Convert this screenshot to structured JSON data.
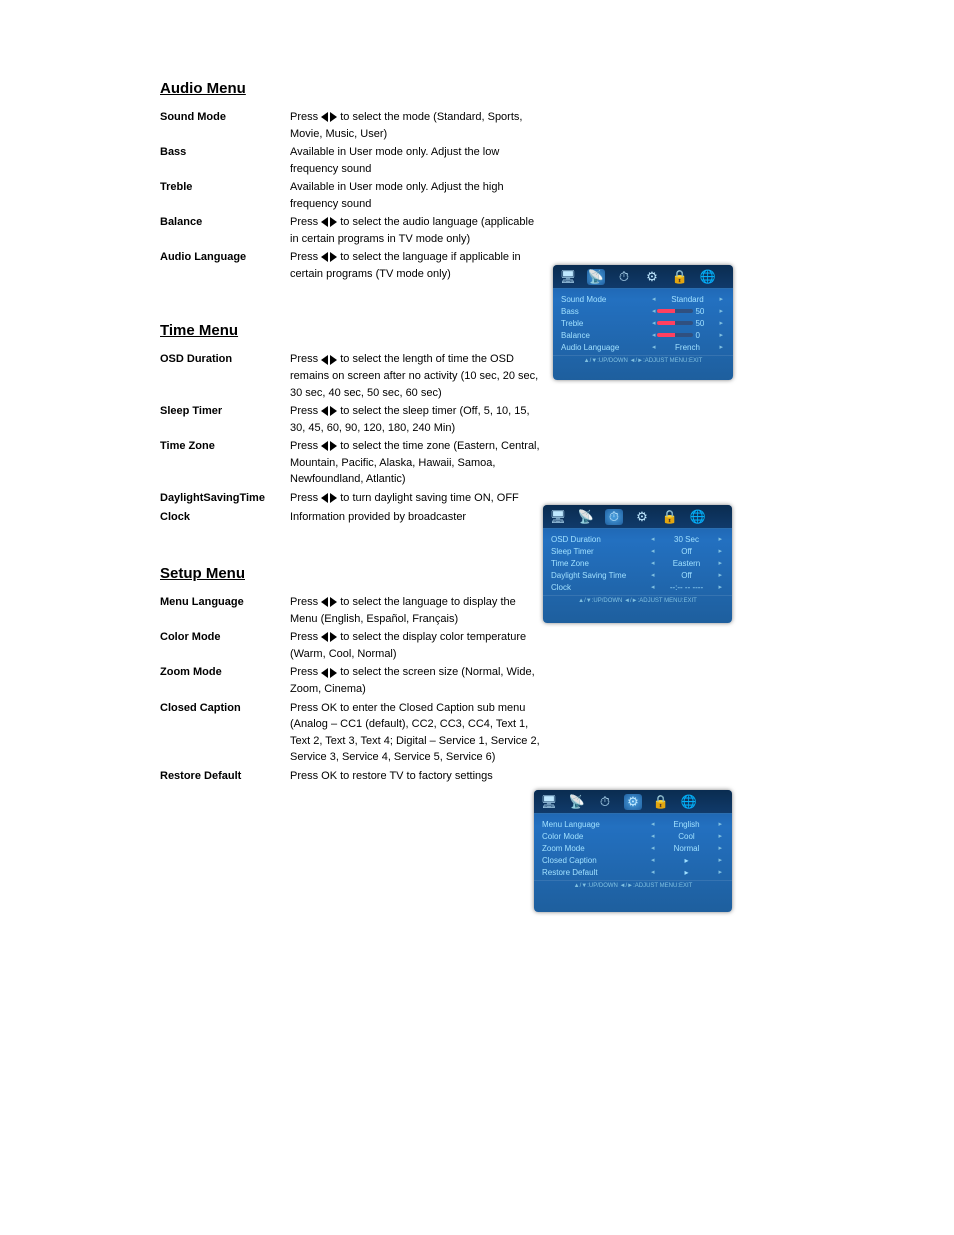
{
  "sections": [
    {
      "title": "Audio Menu",
      "items": [
        {
          "label": "Sound Mode",
          "desc_pre": "Press ",
          "arrows": true,
          "desc_post": " to select the mode (Standard, Sports, Movie, Music, User)"
        },
        {
          "label": "Bass",
          "desc_pre": "",
          "arrows": false,
          "desc_post": "Available in User mode only. Adjust the low frequency sound"
        },
        {
          "label": "Treble",
          "desc_pre": "",
          "arrows": false,
          "desc_post": "Available in User mode only. Adjust the high frequency sound"
        },
        {
          "label": "Balance",
          "desc_pre": "Press ",
          "arrows": true,
          "desc_post": " to select the audio language (applicable in certain programs in TV mode only)"
        },
        {
          "label": "Audio Language",
          "desc_pre": "Press ",
          "arrows": true,
          "desc_post": " to select the language if applicable in certain programs (TV mode only)"
        }
      ]
    },
    {
      "title": "Time Menu",
      "items": [
        {
          "label": "OSD Duration",
          "desc_pre": "Press ",
          "arrows": true,
          "desc_post": " to select the length of time the OSD remains on screen after no activity (10 sec, 20 sec, 30 sec, 40 sec, 50 sec, 60 sec)"
        },
        {
          "label": "Sleep Timer",
          "desc_pre": "Press ",
          "arrows": true,
          "desc_post": " to select the sleep timer (Off, 5, 10, 15, 30, 45, 60, 90, 120, 180, 240 Min)"
        },
        {
          "label": "Time Zone",
          "desc_pre": "Press ",
          "arrows": true,
          "desc_post": " to select the time zone (Eastern, Central, Mountain, Pacific, Alaska, Hawaii, Samoa, Newfoundland, Atlantic)"
        },
        {
          "label": "DaylightSavingTime",
          "desc_pre": "Press ",
          "arrows": true,
          "desc_post": " to turn daylight saving time ON, OFF"
        },
        {
          "label": "Clock",
          "desc_pre": "",
          "arrows": false,
          "desc_post": "Information provided by broadcaster"
        }
      ]
    },
    {
      "title": "Setup Menu",
      "items": [
        {
          "label": "Menu Language",
          "desc_pre": "Press ",
          "arrows": true,
          "desc_post": " to select the language to display the Menu (English, Español, Français)"
        },
        {
          "label": "Color Mode",
          "desc_pre": "Press ",
          "arrows": true,
          "desc_post": " to select the display color temperature (Warm, Cool, Normal)"
        },
        {
          "label": "Zoom Mode",
          "desc_pre": "Press ",
          "arrows": true,
          "desc_post": " to select the screen size (Normal, Wide, Zoom, Cinema)"
        },
        {
          "label": "Closed Caption",
          "desc_pre": "",
          "arrows": false,
          "desc_post": "Press OK to enter the Closed Caption sub menu (Analog – CC1 (default), CC2, CC3, CC4, Text 1, Text 2, Text 3, Text 4; Digital – Service 1, Service 2, Service 3, Service 4, Service 5, Service 6)"
        },
        {
          "label": "Restore Default",
          "desc_pre": "",
          "arrows": false,
          "desc_post": "Press OK to restore TV to factory settings"
        }
      ]
    }
  ],
  "osd1": {
    "footer": "▲/▼:UP/DOWN   ◄/►:ADJUST   MENU:EXIT",
    "icons": [
      "monitor",
      "dish",
      "clock",
      "gear",
      "lock",
      "globe"
    ],
    "active": 1,
    "rows": [
      {
        "l": "Sound Mode",
        "v": "Standard",
        "slider": false
      },
      {
        "l": "Bass",
        "v": "50",
        "slider": true
      },
      {
        "l": "Treble",
        "v": "50",
        "slider": true
      },
      {
        "l": "Balance",
        "v": "0",
        "slider": true
      },
      {
        "l": "Audio Language",
        "v": "French",
        "slider": false
      }
    ]
  },
  "osd2": {
    "footer": "▲/▼:UP/DOWN   ◄/►:ADJUST   MENU:EXIT",
    "icons": [
      "monitor",
      "dish",
      "clock",
      "gear",
      "lock",
      "globe"
    ],
    "active": 2,
    "rows": [
      {
        "l": "OSD Duration",
        "v": "30 Sec"
      },
      {
        "l": "Sleep Timer",
        "v": "Off"
      },
      {
        "l": "Time Zone",
        "v": "Eastern"
      },
      {
        "l": "Daylight Saving Time",
        "v": "Off"
      },
      {
        "l": "Clock",
        "v": "--:-- -- ----"
      }
    ]
  },
  "osd3": {
    "footer": "▲/▼:UP/DOWN   ◄/►:ADJUST   MENU:EXIT",
    "icons": [
      "monitor",
      "dish",
      "clock",
      "gear",
      "lock",
      "globe"
    ],
    "active": 3,
    "rows": [
      {
        "l": "Menu Language",
        "v": "English"
      },
      {
        "l": "Color Mode",
        "v": "Cool"
      },
      {
        "l": "Zoom Mode",
        "v": "Normal"
      },
      {
        "l": "Closed Caption",
        "v": "▸"
      },
      {
        "l": "Restore Default",
        "v": "▸"
      }
    ]
  }
}
